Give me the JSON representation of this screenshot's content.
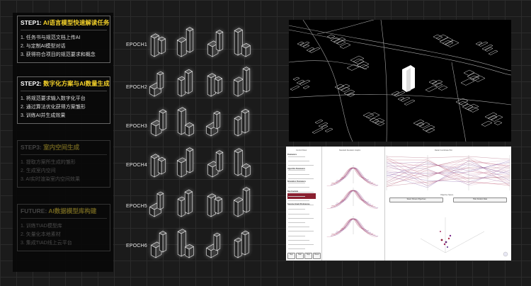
{
  "steps": [
    {
      "prefix": "STEP1:",
      "highlight": "AI语言模型快速解读任务",
      "items": [
        "1. 任务书与规范文档上传AI",
        "2. 与定制AI模型对话",
        "3. 获得符合项目的规范要求和概念"
      ]
    },
    {
      "prefix": "STEP2:",
      "highlight": "数字化方案与AI数量生成",
      "items": [
        "1. 将规范要求输入数字化平台",
        "2. 通过算法优化获得方案雏形",
        "3. 训练AI并生成效果"
      ]
    },
    {
      "prefix": "STEP3:",
      "highlight": "室内空间生成",
      "items": [
        "1. 提取方案所生成的雏形",
        "2. 生成室内空间",
        "3. AI实时渲染室内空间效果"
      ]
    },
    {
      "prefix": "FUTURE:",
      "highlight": "AI数据模型库构建",
      "items": [
        "1. 训练TIAD模型库",
        "2. 矢量化本地素材",
        "3. 集成TIAD线上云平台"
      ]
    }
  ],
  "epochs": [
    "EPOCH1",
    "EPOCH2",
    "EPOCH3",
    "EPOCH4",
    "EPOCH5",
    "EPOCH6"
  ],
  "app": {
    "panes": [
      "Control Panel",
      "Standard Deviation Graphs",
      "Radar Coordinate Plot",
      "Objective Space"
    ],
    "buttons": [
      "Step",
      "Start",
      "Stop",
      "Reset"
    ],
    "section_labels": [
      "Parameters",
      "Algorithm Parameters",
      "Simulation Parameters",
      "Run Controls",
      "Genome Graph Preferences"
    ],
    "subpane_buttons": [
      "Select Fitness Objectives",
      "Hide Solution Data"
    ]
  },
  "colors": {
    "accent": "#f5d22a",
    "background": "#1b1b1b",
    "panel": "#080808",
    "grid": "#2b2b2b"
  }
}
